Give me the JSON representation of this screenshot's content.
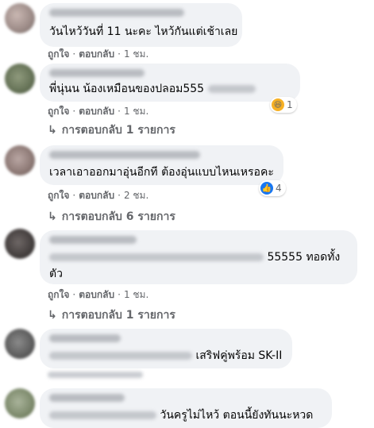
{
  "comments": [
    {
      "text": "วันไหว้วันที่ 11 นะคะ ไหว้กันแต่เช้าเลย",
      "like_label": "ถูกใจ",
      "reply_label": "ตอบกลับ",
      "time": "1 ชม."
    },
    {
      "text": "พี่นุ่นน น้องเหมือนของปลอม555",
      "like_label": "ถูกใจ",
      "reply_label": "ตอบกลับ",
      "time": "1 ชม.",
      "reaction_count": "1",
      "reaction_icon": "haha-icon",
      "replies_label": "การตอบกลับ 1 รายการ"
    },
    {
      "text": "เวลาเอาออกมาอุ่นอีกที ต้องอุ่นแบบไหนเหรอคะ",
      "like_label": "ถูกใจ",
      "reply_label": "ตอบกลับ",
      "time": "2 ชม.",
      "reaction_count": "4",
      "reaction_icon": "like-icon",
      "replies_label": "การตอบกลับ 6 รายการ"
    },
    {
      "text_line1": "55555 ทอดทั้ง",
      "text_line2": "ตัว",
      "like_label": "ถูกใจ",
      "reply_label": "ตอบกลับ",
      "time": "1 ชม.",
      "replies_label": "การตอบกลับ 1 รายการ"
    },
    {
      "text": "เสริฟคู่พร้อม SK-II"
    },
    {
      "text": "วันครูไม่ไหว้ ตอนนี้ยังทันนะหวด"
    }
  ],
  "colors": {
    "bubble": "#f0f2f5",
    "meta": "#65676b",
    "text": "#050505",
    "like_blue": "#1877f2",
    "haha_yellow": "#f7b125"
  }
}
